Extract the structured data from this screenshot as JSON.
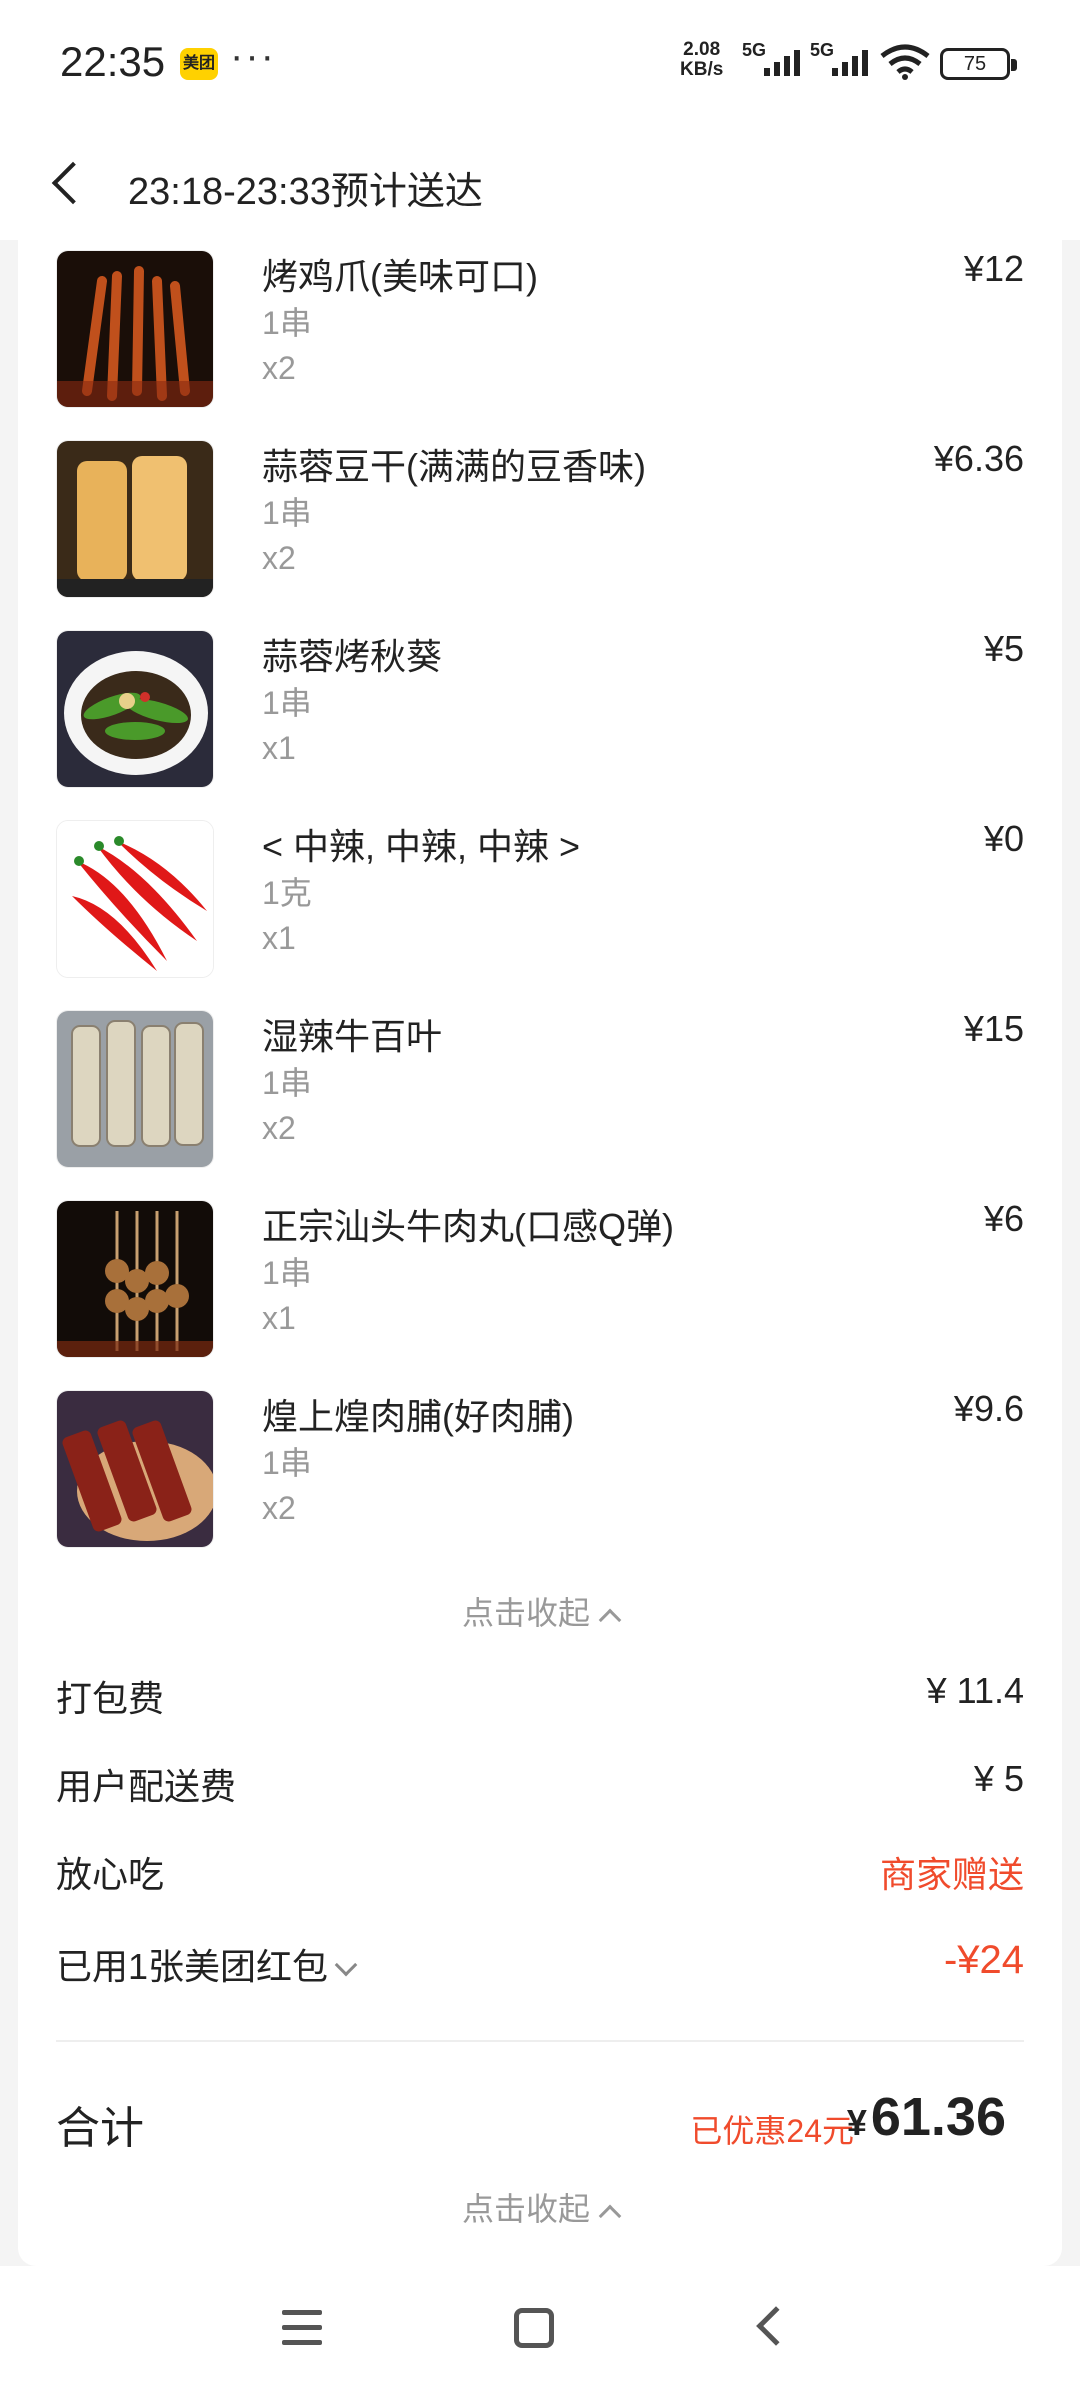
{
  "status_bar": {
    "time": "22:35",
    "app_badge": "美团",
    "more": "···",
    "net_speed_top": "2.08",
    "net_speed_bottom": "KB/s",
    "sim1": "5G",
    "sim2": "5G",
    "battery": "75"
  },
  "header": {
    "title": "23:18-23:33预计送达"
  },
  "items": [
    {
      "name": "烤鸡爪(美味可口)",
      "spec": "1串",
      "qty": "x2",
      "price": "¥12"
    },
    {
      "name": "蒜蓉豆干(满满的豆香味)",
      "spec": "1串",
      "qty": "x2",
      "price": "¥6.36"
    },
    {
      "name": "蒜蓉烤秋葵",
      "spec": "1串",
      "qty": "x1",
      "price": "¥5"
    },
    {
      "name": "< 中辣, 中辣, 中辣 >",
      "spec": "1克",
      "qty": "x1",
      "price": "¥0"
    },
    {
      "name": "湿辣牛百叶",
      "spec": "1串",
      "qty": "x2",
      "price": "¥15"
    },
    {
      "name": "正宗汕头牛肉丸(口感Q弹)",
      "spec": "1串",
      "qty": "x1",
      "price": "¥6"
    },
    {
      "name": "煌上煌肉脯(好肉脯)",
      "spec": "1串",
      "qty": "x2",
      "price": "¥9.6"
    }
  ],
  "collapse_label": "点击收起",
  "fees": {
    "packing_label": "打包费",
    "packing_value": "¥ 11.4",
    "delivery_label": "用户配送费",
    "delivery_value": "¥ 5",
    "assurance_label": "放心吃",
    "assurance_value": "商家赠送",
    "redpacket_label": "已用1张美团红包",
    "redpacket_value": "-¥24"
  },
  "total": {
    "label": "合计",
    "saved": "已优惠24元",
    "currency": "¥",
    "amount": "61.36"
  },
  "collapse_label_bottom": "点击收起",
  "colors": {
    "accent_red": "#f04b2c",
    "meituan_yellow": "#ffd100"
  }
}
